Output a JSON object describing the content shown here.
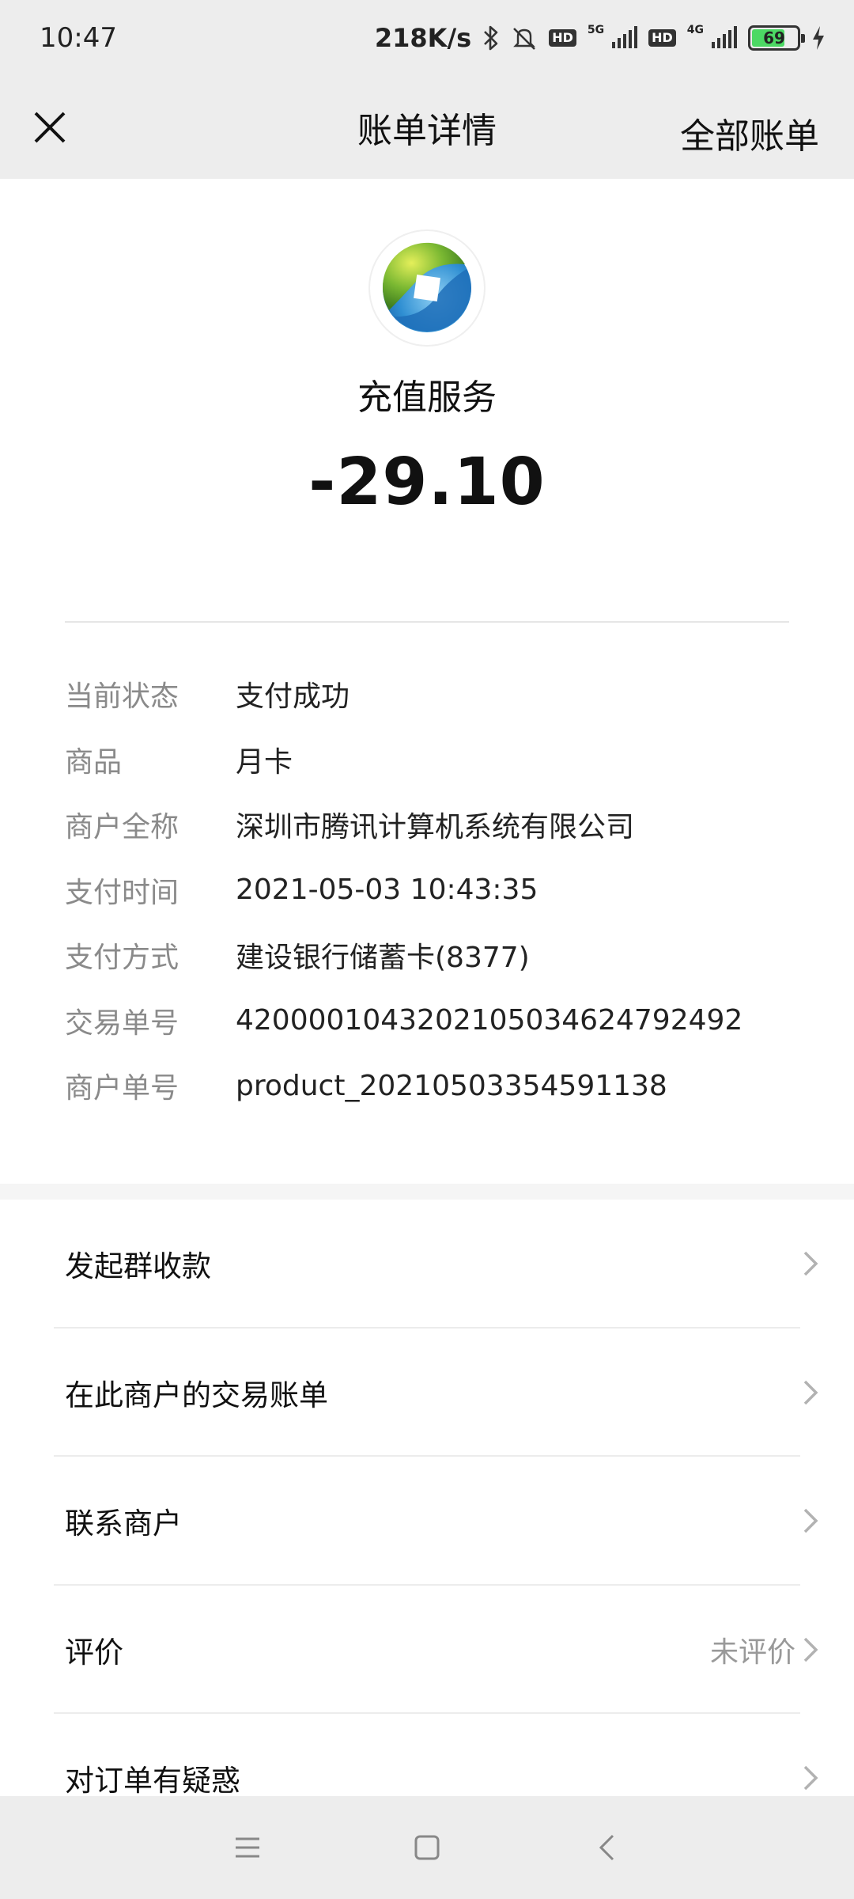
{
  "status_bar": {
    "time": "10:47",
    "speed": "218K/s",
    "network_5g": "5G",
    "network_4g": "4G",
    "battery": "69",
    "icons": [
      "bluetooth-icon",
      "mute-bell-icon",
      "hd-icon",
      "signal-icon",
      "charging-icon"
    ]
  },
  "nav": {
    "title": "账单详情",
    "right_label": "全部账单",
    "close_icon": "close-icon"
  },
  "header": {
    "merchant_title": "充值服务",
    "amount": "-29.10"
  },
  "details": [
    {
      "label": "当前状态",
      "value": "支付成功"
    },
    {
      "label": "商品",
      "value": "月卡"
    },
    {
      "label": "商户全称",
      "value": "深圳市腾讯计算机系统有限公司"
    },
    {
      "label": "支付时间",
      "value": "2021-05-03 10:43:35"
    },
    {
      "label": "支付方式",
      "value": "建设银行储蓄卡(8377)"
    },
    {
      "label": "交易单号",
      "value": "4200001043202105034624792492"
    },
    {
      "label": "商户单号",
      "value": "product_20210503354591138"
    }
  ],
  "actions": [
    {
      "label": "发起群收款",
      "secondary": ""
    },
    {
      "label": "在此商户的交易账单",
      "secondary": ""
    },
    {
      "label": "联系商户",
      "secondary": ""
    },
    {
      "label": "评价",
      "secondary": "未评价"
    },
    {
      "label": "对订单有疑惑",
      "secondary": ""
    }
  ],
  "colors": {
    "bar_background": "#ededed",
    "label_gray": "#8a8a8a",
    "battery_green": "#4cd964"
  }
}
